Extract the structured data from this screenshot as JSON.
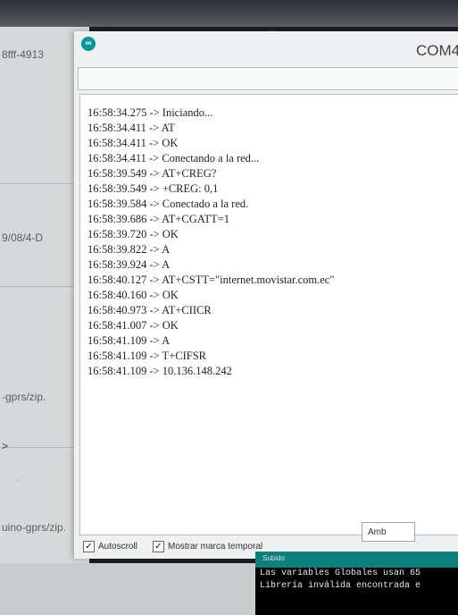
{
  "background": {
    "fragments": [
      "8fff-4913",
      "9/08/4-D",
      "-gprs/zip.",
      "uino-gprs/zip."
    ],
    "arrow": ">"
  },
  "serial_monitor": {
    "title": "COM4",
    "input_value": "",
    "log": [
      "16:58:34.275 -> Iniciando...",
      "16:58:34.411 -> AT",
      "16:58:34.411 -> OK",
      "16:58:34.411 -> Conectando a la red...",
      "16:58:39.549 -> AT+CREG?",
      "16:58:39.549 -> +CREG: 0,1",
      "16:58:39.584 -> Conectado a la red.",
      "16:58:39.686 -> AT+CGATT=1",
      "16:58:39.720 -> OK",
      "16:58:39.822 -> A",
      "16:58:39.924 -> A",
      "16:58:40.127 -> AT+CSTT=\"internet.movistar.com.ec\"",
      "16:58:40.160 -> OK",
      "16:58:40.973 -> AT+CIICR",
      "16:58:41.007 -> OK",
      "16:58:41.109 -> A",
      "16:58:41.109 -> T+CIFSR",
      "16:58:41.109 -> 10.136.148.242"
    ],
    "autoscroll_label": "Autoscroll",
    "timestamp_label": "Mostrar marca temporal",
    "line_ending_value": "Amb"
  },
  "console": {
    "header": "Subido",
    "lines": [
      "Las variables Globales usan 65",
      "Librería inválida encontrada e"
    ]
  },
  "colors": {
    "accent": "#00979c",
    "console_bg": "#000000"
  }
}
